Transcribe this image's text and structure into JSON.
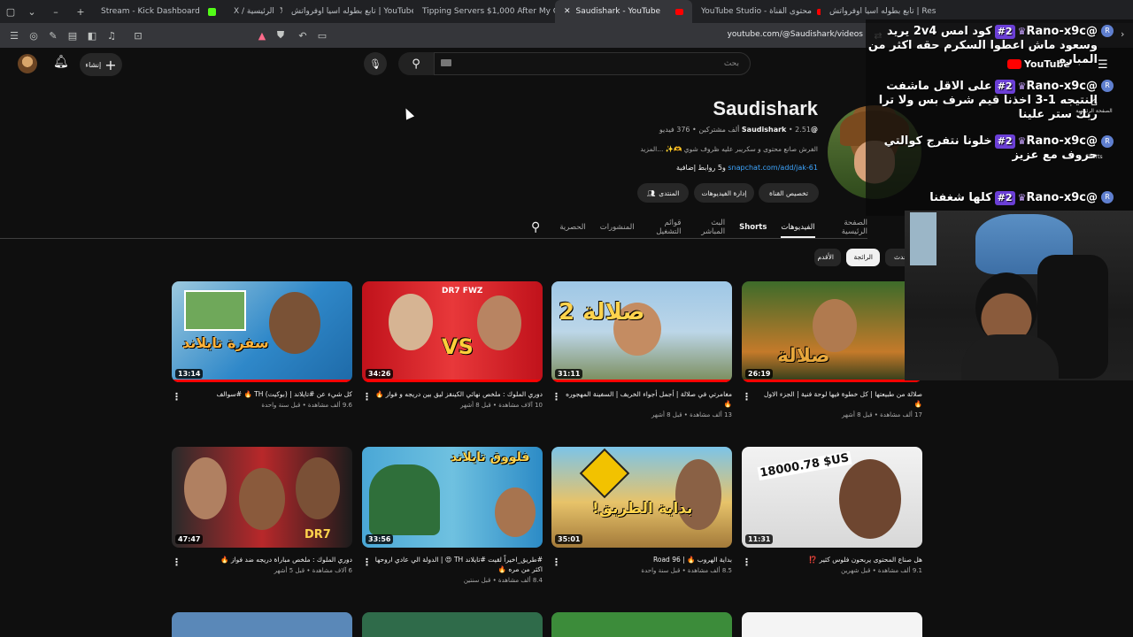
{
  "browser": {
    "tabs": [
      {
        "title": "Stream - Kick Dashboard"
      },
      {
        "title": "X / الرئيسية"
      },
      {
        "title": "تابع بطوله اسيا اوفرواتش | YouTube"
      },
      {
        "title": "Tipping Servers $1,000 After My Car"
      },
      {
        "title": "Saudishark - YouTube"
      },
      {
        "title": "YouTube Studio - محتوى القناة"
      },
      {
        "title": "تابع بطوله اسيا اوفرواتش | Restream"
      }
    ],
    "url": "youtube.com/@Saudishark/videos"
  },
  "header": {
    "create_label": "إنشاء",
    "search_placeholder": "بحث"
  },
  "channel": {
    "name": "Saudishark",
    "handle": "@Saudishark",
    "stats": "• 2.51 ألف مشتركين • 376 فيديو",
    "description": "الفرش صانع محتوى و سكريبر عليه ظروف شوي 🫶✨ ...المزيد",
    "link": "snapchat.com/add/jak-61",
    "link_more": "و5 روابط إضافية",
    "buttons": {
      "customize": "تخصيص القناة",
      "manage": "إدارة الفيديوهات",
      "community": "المنتدى"
    }
  },
  "tabs": [
    "الصفحة الرئيسية",
    "الفيديوهات",
    "Shorts",
    "البث المباشر",
    "قوائم التشغيل",
    "المنشورات",
    "الحصرية"
  ],
  "chips": [
    "الأحدث",
    "الرائجة",
    "الأقدم"
  ],
  "videos": [
    {
      "title": "صلالة من طبيعتها | كل خطوة فيها لوحة فنية | الجزء الاول 🔥",
      "meta": "17 ألف مشاهدة • قبل 8 أشهر",
      "duration": "26:19",
      "thumb_text": "صلالة"
    },
    {
      "title": "مغامرتي في صلالة | أجمل أجواء الخريف | السفينة المهجوره 🔥",
      "meta": "13 ألف مشاهدة • قبل 8 أشهر",
      "duration": "31:11",
      "thumb_text": "صلالة 2"
    },
    {
      "title": "دوري الملوك : ملخص نهائي الكينقز ليق بين دريجه و فواز 🔥",
      "meta": "10 آلاف مشاهدة • قبل 8 أشهر",
      "duration": "34:26",
      "thumb_text": "VS"
    },
    {
      "title": "كل شيء عن #تايلاند | (بوكيت) TH 🔥 #سوالف",
      "meta": "9.6 ألف مشاهدة • قبل سنة واحدة",
      "duration": "13:14",
      "thumb_text": "سفرة تايلاند"
    },
    {
      "title": "هل صناع المحتوى يربحون فلوس كثير ⁉️",
      "meta": "9.1 ألف مشاهدة • قبل شهرين",
      "duration": "11:31",
      "thumb_text": "18000.78 $US"
    },
    {
      "title": "بداية الهروب 🔥 | Road 96",
      "meta": "8.5 ألف مشاهدة • قبل سنة واحدة",
      "duration": "35:01",
      "thumb_text": "بداية الطريق!"
    },
    {
      "title": "#طريق_اخيراً لقيت #تايلاند TH 😍 | الدولة الي عادي اروحها اكثر من مره 🔥",
      "meta": "8.4 ألف مشاهدة • قبل سنتين",
      "duration": "33:56",
      "thumb_text": "فلووق تايلاند"
    },
    {
      "title": "دوري الملوك : ملخص مباراة دريجه ضد فواز 🔥",
      "meta": "6 آلاف مشاهدة • قبل 5 أشهر",
      "duration": "47:47",
      "thumb_text": "DR7"
    }
  ],
  "chat": [
    {
      "user": "@Rano-x9c",
      "rank": "#2",
      "text": "كود امس 2v4 يريد وسعود ماش اعطوا السكرم حقه اكثر من المباره"
    },
    {
      "user": "@Rano-x9c",
      "rank": "#2",
      "text": "على الاقل ماشفت النتيجه 1-3 اخذنا قيم شرف بس ولا ترا ربك ستر علينا"
    },
    {
      "user": "@Rano-x9c",
      "rank": "#2",
      "text": "خلونا نتفرج كوالتي حروف مع عزيز"
    },
    {
      "user": "@Rano-x9c",
      "rank": "#2",
      "text": "كلها شغفنا"
    }
  ],
  "overlay": {
    "yt_logo": "YouTube",
    "home_label": "الصفحة الرئيسية",
    "shorts_label": "Shorts"
  },
  "colors": {
    "accent": "#ff0000",
    "bg": "#0f0f0f",
    "link": "#3ea6ff",
    "badge": "#6b3fd6"
  }
}
